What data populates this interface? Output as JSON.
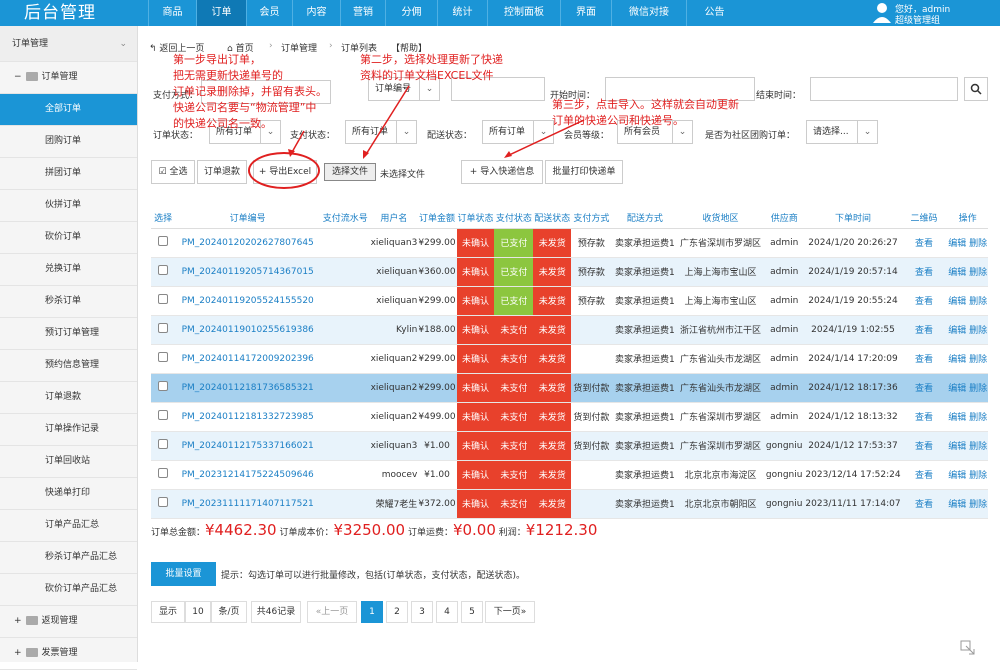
{
  "app": {
    "title": "后台管理"
  },
  "nav": [
    "商品",
    "订单",
    "会员",
    "内容",
    "营销",
    "分佣",
    "统计",
    "控制面板",
    "界面",
    "微信对接",
    "公告"
  ],
  "user": {
    "greeting": "您好，admin",
    "role": "超级管理组"
  },
  "sidebar": {
    "section": "订单管理",
    "group": "订单管理",
    "items": [
      "全部订单",
      "团购订单",
      "拼团订单",
      "伙拼订单",
      "砍价订单",
      "兑换订单",
      "秒杀订单",
      "预订订单管理",
      "预约信息管理",
      "订单退款",
      "订单操作记录",
      "订单回收站",
      "快递单打印",
      "订单产品汇总",
      "秒杀订单产品汇总",
      "砍价订单产品汇总"
    ],
    "groups": [
      "返现管理",
      "发票管理"
    ]
  },
  "breadcrumb": {
    "back": "返回上一页",
    "home": "首页",
    "orders": "订单管理",
    "list": "订单列表",
    "help": "【帮助】"
  },
  "filters": {
    "pay_method": "支付方式：",
    "order_no": "订单编号",
    "start": "开始时间：",
    "end": "结束时间：",
    "order_status_lbl": "订单状态：",
    "order_status": "所有订单",
    "pay_status_lbl": "支付状态：",
    "pay_status": "所有订单",
    "ship_status_lbl": "配送状态：",
    "ship_status": "所有订单",
    "member_lbl": "会员等级：",
    "member": "所有会员",
    "group_lbl": "是否为社区团购订单：",
    "group": "请选择..."
  },
  "toolbar": {
    "select_all": "全选",
    "refund": "订单退款",
    "export": "导出Excel",
    "choose_file": "选择文件",
    "no_file": "未选择文件",
    "import": "导入快递信息",
    "batch_print": "批量打印快递单"
  },
  "annotations": {
    "step1": "第一步导出订单，\n把无需更新快递单号的\n订单记录删除掉，并留有表头。\n快递公司名要与“物流管理”中\n的快递公司名一致。",
    "step2": "第二步，选择处理更新了快递\n资料的订单文档EXCEL文件",
    "step3": "第三步，点击导入。这样就会自动更新\n订单的快递公司和快递号。"
  },
  "table": {
    "headers": [
      "选择",
      "订单编号",
      "支付流水号",
      "用户名",
      "订单金额",
      "订单状态",
      "支付状态",
      "配送状态",
      "支付方式",
      "配送方式",
      "收货地区",
      "供应商",
      "下单时间",
      "二维码",
      "操作"
    ],
    "rows": [
      {
        "no": "PM_20240120202627807645",
        "user": "xieliquan3",
        "amount": "¥299.00",
        "os": "未确认",
        "ps": "已支付",
        "ss": "未发货",
        "pay": "预存款",
        "ship": "卖家承担运费1",
        "area": "广东省深圳市罗湖区",
        "sup": "admin",
        "time": "2024/1/20 20:26:27"
      },
      {
        "no": "PM_20240119205714367015",
        "user": "xieliquan",
        "amount": "¥360.00",
        "os": "未确认",
        "ps": "已支付",
        "ss": "未发货",
        "pay": "预存款",
        "ship": "卖家承担运费1",
        "area": "上海上海市宝山区",
        "sup": "admin",
        "time": "2024/1/19 20:57:14"
      },
      {
        "no": "PM_20240119205524155520",
        "user": "xieliquan",
        "amount": "¥299.00",
        "os": "未确认",
        "ps": "已支付",
        "ss": "未发货",
        "pay": "预存款",
        "ship": "卖家承担运费1",
        "area": "上海上海市宝山区",
        "sup": "admin",
        "time": "2024/1/19 20:55:24"
      },
      {
        "no": "PM_20240119010255619386",
        "user": "Kylin",
        "amount": "¥188.00",
        "os": "未确认",
        "ps": "未支付",
        "ss": "未发货",
        "pay": "",
        "ship": "卖家承担运费1",
        "area": "浙江省杭州市江干区",
        "sup": "admin",
        "time": "2024/1/19 1:02:55"
      },
      {
        "no": "PM_20240114172009202396",
        "user": "xieliquan2",
        "amount": "¥299.00",
        "os": "未确认",
        "ps": "未支付",
        "ss": "未发货",
        "pay": "",
        "ship": "卖家承担运费1",
        "area": "广东省汕头市龙湖区",
        "sup": "admin",
        "time": "2024/1/14 17:20:09"
      },
      {
        "no": "PM_20240112181736585321",
        "user": "xieliquan2",
        "amount": "¥299.00",
        "os": "未确认",
        "ps": "未支付",
        "ss": "未发货",
        "pay": "货到付款",
        "ship": "卖家承担运费1",
        "area": "广东省汕头市龙湖区",
        "sup": "admin",
        "time": "2024/1/12 18:17:36"
      },
      {
        "no": "PM_20240112181332723985",
        "user": "xieliquan2",
        "amount": "¥499.00",
        "os": "未确认",
        "ps": "未支付",
        "ss": "未发货",
        "pay": "货到付款",
        "ship": "卖家承担运费1",
        "area": "广东省深圳市罗湖区",
        "sup": "admin",
        "time": "2024/1/12 18:13:32"
      },
      {
        "no": "PM_20240112175337166021",
        "user": "xieliquan3",
        "amount": "¥1.00",
        "os": "未确认",
        "ps": "未支付",
        "ss": "未发货",
        "pay": "货到付款",
        "ship": "卖家承担运费1",
        "area": "广东省深圳市罗湖区",
        "sup": "gongniu",
        "time": "2024/1/12 17:53:37"
      },
      {
        "no": "PM_20231214175224509646",
        "user": "moocev",
        "amount": "¥1.00",
        "os": "未确认",
        "ps": "未支付",
        "ss": "未发货",
        "pay": "",
        "ship": "卖家承担运费1",
        "area": "北京北京市海淀区",
        "sup": "gongniu",
        "time": "2023/12/14 17:52:24"
      },
      {
        "no": "PM_20231111171407117521",
        "user": "荣耀7老生",
        "amount": "¥372.00",
        "os": "未确认",
        "ps": "未支付",
        "ss": "未发货",
        "pay": "",
        "ship": "卖家承担运费1",
        "area": "北京北京市朝阳区",
        "sup": "gongniu",
        "time": "2023/11/11 17:14:07"
      }
    ],
    "view": "查看",
    "edit": "编辑",
    "del": "删除"
  },
  "summary": {
    "total_lbl": "订单总金额：",
    "total": "¥4462.30",
    "cost_lbl": "订单成本价：",
    "cost": "¥3250.00",
    "freight_lbl": "订单运费：",
    "freight": "¥0.00",
    "profit_lbl": "利润：",
    "profit": "¥1212.30"
  },
  "batch": {
    "btn": "批量设置",
    "tip": "提示：勾选订单可以进行批量修改，包括(订单状态，支付状态，配送状态)。"
  },
  "pager": {
    "show": "显示",
    "size": "10",
    "per": "条/页",
    "total": "共46记录",
    "prev": "«上一页",
    "pages": [
      "1",
      "2",
      "3",
      "4",
      "5"
    ],
    "next": "下一页»"
  },
  "colors": {
    "primary": "#1b95d6",
    "red": "#e8412c",
    "green": "#8cc63f"
  }
}
